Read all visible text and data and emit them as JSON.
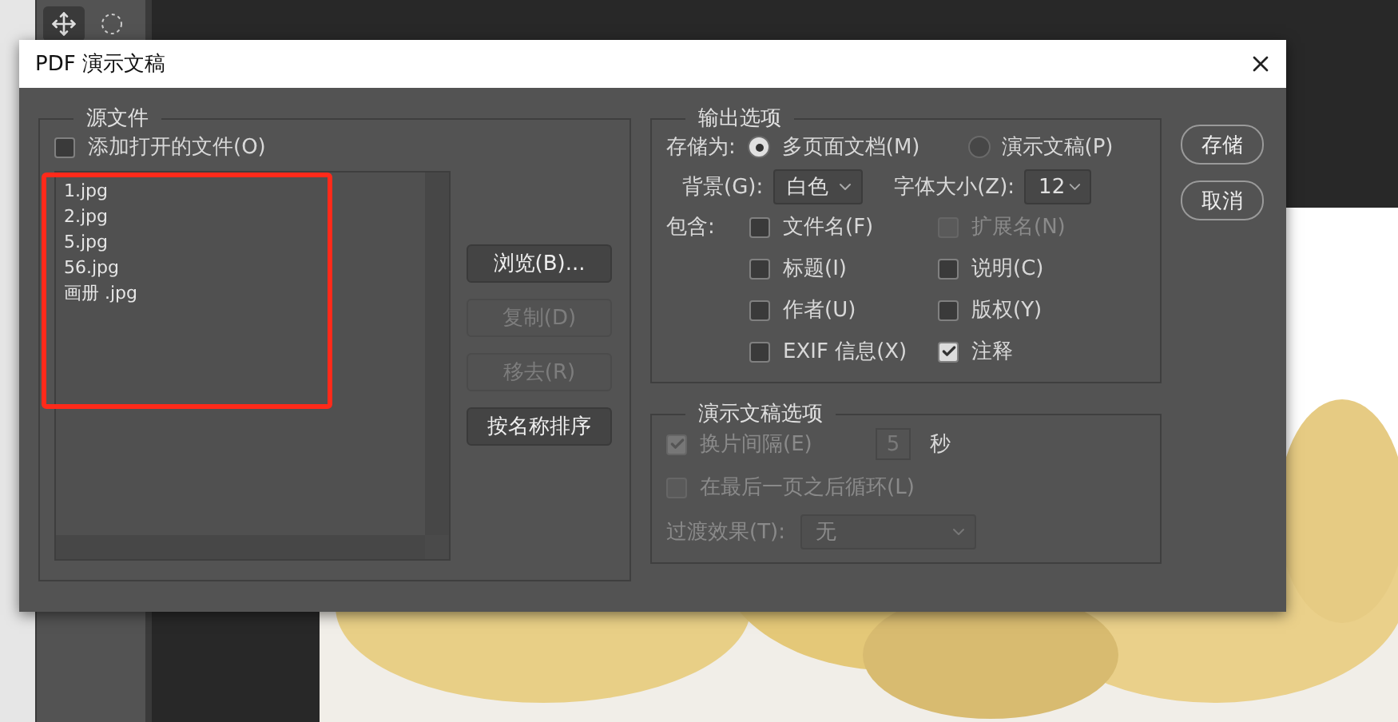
{
  "window": {
    "title": "PDF 演示文稿"
  },
  "source_files": {
    "title": "源文件",
    "add_open_files": {
      "label": "添加打开的文件(O)",
      "checked": false
    },
    "files": [
      {
        "name": "1.jpg"
      },
      {
        "name": "2.jpg"
      },
      {
        "name": "5.jpg"
      },
      {
        "name": "56.jpg"
      },
      {
        "name": "画册 .jpg"
      }
    ],
    "buttons": [
      {
        "label": "浏览(B)...",
        "disabled": false
      },
      {
        "label": "复制(D)",
        "disabled": true
      },
      {
        "label": "移去(R)",
        "disabled": true
      },
      {
        "label": "按名称排序",
        "disabled": false
      }
    ]
  },
  "output_options": {
    "title": "输出选项",
    "save_as": {
      "label": "存储为:",
      "options": [
        {
          "label": "多页面文档(M)",
          "selected": true
        },
        {
          "label": "演示文稿(P)",
          "selected": false
        }
      ]
    },
    "background": {
      "label": "背景(G):",
      "value": "白色"
    },
    "font_size": {
      "label": "字体大小(Z):",
      "value": "12"
    },
    "include": {
      "label": "包含:",
      "items": [
        {
          "label": "文件名(F)",
          "checked": false,
          "disabled": false
        },
        {
          "label": "扩展名(N)",
          "checked": false,
          "disabled": true
        },
        {
          "label": "标题(I)",
          "checked": false,
          "disabled": false
        },
        {
          "label": "说明(C)",
          "checked": false,
          "disabled": false
        },
        {
          "label": "作者(U)",
          "checked": false,
          "disabled": false
        },
        {
          "label": "版权(Y)",
          "checked": false,
          "disabled": false
        },
        {
          "label": "EXIF 信息(X)",
          "checked": false,
          "disabled": false
        },
        {
          "label": "注释",
          "checked": true,
          "disabled": false
        }
      ]
    }
  },
  "presentation_options": {
    "title": "演示文稿选项",
    "disabled": true,
    "advance": {
      "label": "换片间隔(E)",
      "checked": true,
      "value": "5",
      "unit": "秒"
    },
    "loop": {
      "label": "在最后一页之后循环(L)",
      "checked": false
    },
    "transition": {
      "label": "过渡效果(T):",
      "value": "无"
    }
  },
  "dialog_buttons": [
    {
      "label": "存储"
    },
    {
      "label": "取消"
    }
  ]
}
